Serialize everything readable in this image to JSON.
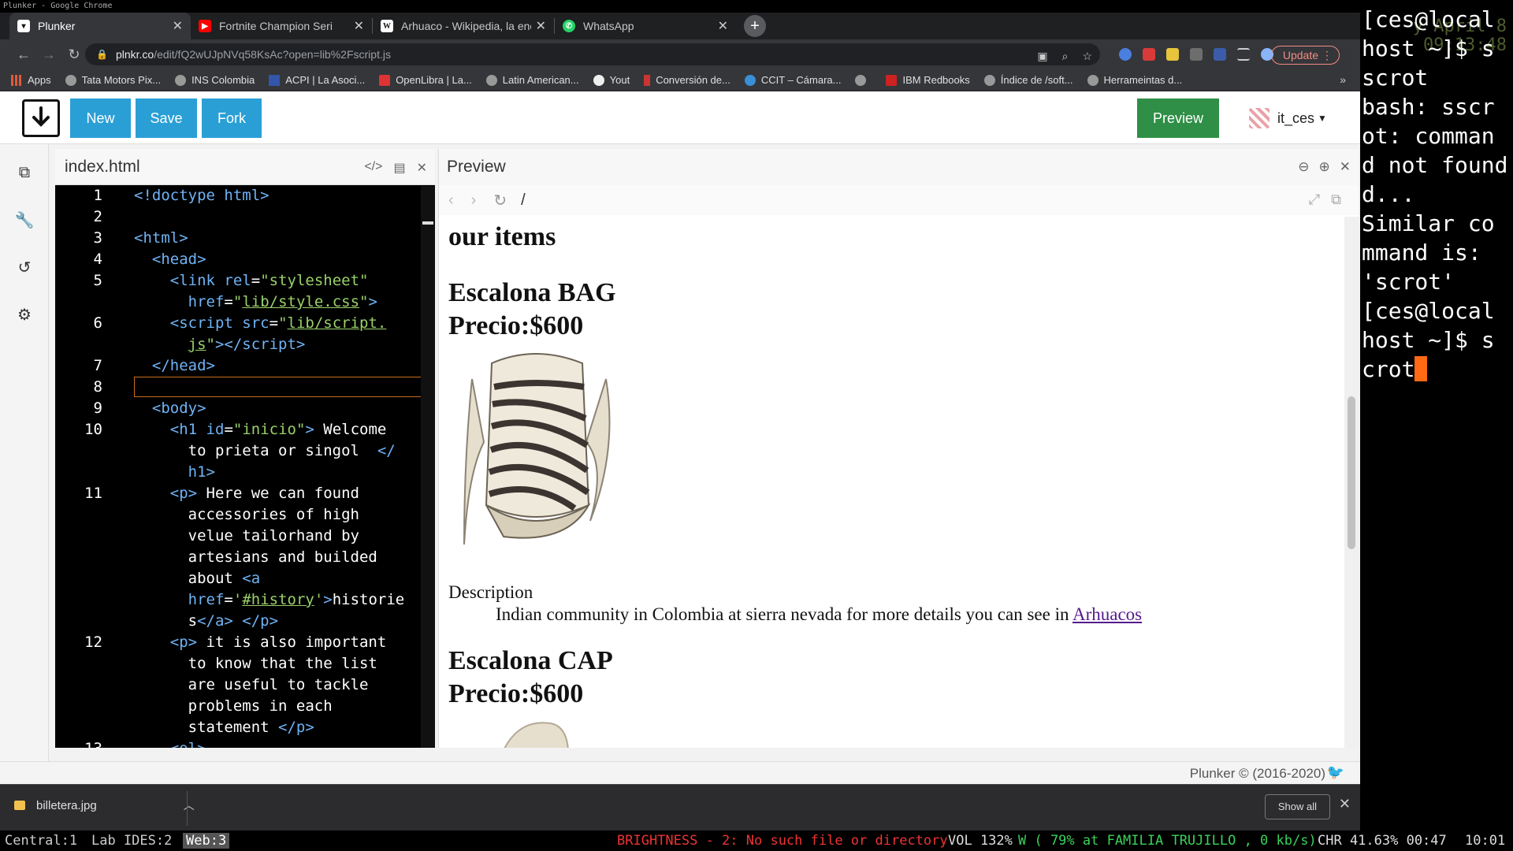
{
  "wm_title": "Plunker - Google Chrome",
  "tabs": [
    {
      "title": "Plunker",
      "color": "#ffffff",
      "icon": "plunker-icon"
    },
    {
      "title": "Fortnite Champion Seri",
      "color": "#ff0000",
      "icon": "youtube-icon"
    },
    {
      "title": "Arhuaco - Wikipedia, la enc",
      "color": "#ffffff",
      "icon": "wikipedia-icon"
    },
    {
      "title": "WhatsApp",
      "color": "#25d366",
      "icon": "whatsapp-icon"
    }
  ],
  "url_host": "plnkr.co",
  "url_rest": "/edit/fQ2wUJpNVq58KsAc?open=lib%2Fscript.js",
  "update_label": "Update",
  "bookmarks": [
    "Apps",
    "Tata Motors Pix...",
    "INS Colombia",
    "ACPI | La Asoci...",
    "OpenLibra | La...",
    "Latin American...",
    "Yout",
    "Conversión de...",
    "CCIT – Cámara...",
    "",
    "IBM Redbooks",
    "Índice de /soft...",
    "Herrameintas d..."
  ],
  "plunker": {
    "new_label": "New",
    "save_label": "Save",
    "fork_label": "Fork",
    "preview_label": "Preview",
    "username": "it_ces",
    "accent": "#2a9fd6",
    "preview_color": "#2f8f46"
  },
  "editor": {
    "filename": "index.html",
    "current_line": 10
  },
  "preview": {
    "title": "Preview",
    "path": "/",
    "heading": "our items",
    "item1_name": "Escalona BAG",
    "item1_price": "Precio:$600",
    "desc_term": "Description",
    "desc_text": "Indian community in Colombia at sierra nevada for more details you can see in ",
    "desc_link": "Arhuacos",
    "item2_name": "Escalona CAP",
    "item2_price": "Precio:$600"
  },
  "footer_text": "Plunker © (2016-2020)",
  "download": {
    "filename": "billetera.jpg",
    "show_all": "Show all"
  },
  "terminal": {
    "clock_lines": [
      "y April  8",
      "09:13:48"
    ],
    "lines": [
      "[ces@local",
      "host ~]$ s",
      "scrot",
      "bash: sscr",
      "ot: comman",
      "d not found",
      "d...",
      "Similar co",
      "mmand is:",
      "'scrot'",
      "[ces@local",
      "host ~]$ s",
      "crot"
    ]
  },
  "statusbar": {
    "workspaces": [
      "Central:1",
      "Lab IDES:2",
      "Web:3"
    ],
    "active_workspace": "Web:3",
    "brightness": "BRIGHTNESS - 2: No such file or directory",
    "volume": "VOL 132%",
    "wifi": "W ( 79% at FAMILIA TRUJILLO , 0 kb/s)",
    "battery": "CHR 41.63% 00:47",
    "time": "10:01"
  }
}
